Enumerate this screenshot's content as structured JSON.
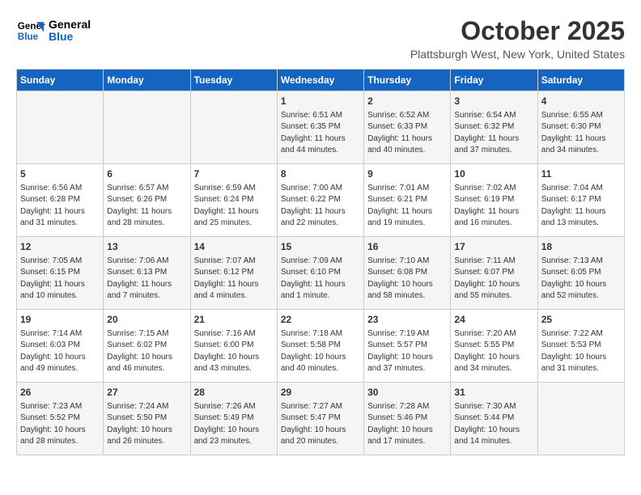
{
  "logo": {
    "line1": "General",
    "line2": "Blue"
  },
  "title": "October 2025",
  "subtitle": "Plattsburgh West, New York, United States",
  "days_of_week": [
    "Sunday",
    "Monday",
    "Tuesday",
    "Wednesday",
    "Thursday",
    "Friday",
    "Saturday"
  ],
  "weeks": [
    [
      {
        "day": "",
        "info": ""
      },
      {
        "day": "",
        "info": ""
      },
      {
        "day": "",
        "info": ""
      },
      {
        "day": "1",
        "info": "Sunrise: 6:51 AM\nSunset: 6:35 PM\nDaylight: 11 hours\nand 44 minutes."
      },
      {
        "day": "2",
        "info": "Sunrise: 6:52 AM\nSunset: 6:33 PM\nDaylight: 11 hours\nand 40 minutes."
      },
      {
        "day": "3",
        "info": "Sunrise: 6:54 AM\nSunset: 6:32 PM\nDaylight: 11 hours\nand 37 minutes."
      },
      {
        "day": "4",
        "info": "Sunrise: 6:55 AM\nSunset: 6:30 PM\nDaylight: 11 hours\nand 34 minutes."
      }
    ],
    [
      {
        "day": "5",
        "info": "Sunrise: 6:56 AM\nSunset: 6:28 PM\nDaylight: 11 hours\nand 31 minutes."
      },
      {
        "day": "6",
        "info": "Sunrise: 6:57 AM\nSunset: 6:26 PM\nDaylight: 11 hours\nand 28 minutes."
      },
      {
        "day": "7",
        "info": "Sunrise: 6:59 AM\nSunset: 6:24 PM\nDaylight: 11 hours\nand 25 minutes."
      },
      {
        "day": "8",
        "info": "Sunrise: 7:00 AM\nSunset: 6:22 PM\nDaylight: 11 hours\nand 22 minutes."
      },
      {
        "day": "9",
        "info": "Sunrise: 7:01 AM\nSunset: 6:21 PM\nDaylight: 11 hours\nand 19 minutes."
      },
      {
        "day": "10",
        "info": "Sunrise: 7:02 AM\nSunset: 6:19 PM\nDaylight: 11 hours\nand 16 minutes."
      },
      {
        "day": "11",
        "info": "Sunrise: 7:04 AM\nSunset: 6:17 PM\nDaylight: 11 hours\nand 13 minutes."
      }
    ],
    [
      {
        "day": "12",
        "info": "Sunrise: 7:05 AM\nSunset: 6:15 PM\nDaylight: 11 hours\nand 10 minutes."
      },
      {
        "day": "13",
        "info": "Sunrise: 7:06 AM\nSunset: 6:13 PM\nDaylight: 11 hours\nand 7 minutes."
      },
      {
        "day": "14",
        "info": "Sunrise: 7:07 AM\nSunset: 6:12 PM\nDaylight: 11 hours\nand 4 minutes."
      },
      {
        "day": "15",
        "info": "Sunrise: 7:09 AM\nSunset: 6:10 PM\nDaylight: 11 hours\nand 1 minute."
      },
      {
        "day": "16",
        "info": "Sunrise: 7:10 AM\nSunset: 6:08 PM\nDaylight: 10 hours\nand 58 minutes."
      },
      {
        "day": "17",
        "info": "Sunrise: 7:11 AM\nSunset: 6:07 PM\nDaylight: 10 hours\nand 55 minutes."
      },
      {
        "day": "18",
        "info": "Sunrise: 7:13 AM\nSunset: 6:05 PM\nDaylight: 10 hours\nand 52 minutes."
      }
    ],
    [
      {
        "day": "19",
        "info": "Sunrise: 7:14 AM\nSunset: 6:03 PM\nDaylight: 10 hours\nand 49 minutes."
      },
      {
        "day": "20",
        "info": "Sunrise: 7:15 AM\nSunset: 6:02 PM\nDaylight: 10 hours\nand 46 minutes."
      },
      {
        "day": "21",
        "info": "Sunrise: 7:16 AM\nSunset: 6:00 PM\nDaylight: 10 hours\nand 43 minutes."
      },
      {
        "day": "22",
        "info": "Sunrise: 7:18 AM\nSunset: 5:58 PM\nDaylight: 10 hours\nand 40 minutes."
      },
      {
        "day": "23",
        "info": "Sunrise: 7:19 AM\nSunset: 5:57 PM\nDaylight: 10 hours\nand 37 minutes."
      },
      {
        "day": "24",
        "info": "Sunrise: 7:20 AM\nSunset: 5:55 PM\nDaylight: 10 hours\nand 34 minutes."
      },
      {
        "day": "25",
        "info": "Sunrise: 7:22 AM\nSunset: 5:53 PM\nDaylight: 10 hours\nand 31 minutes."
      }
    ],
    [
      {
        "day": "26",
        "info": "Sunrise: 7:23 AM\nSunset: 5:52 PM\nDaylight: 10 hours\nand 28 minutes."
      },
      {
        "day": "27",
        "info": "Sunrise: 7:24 AM\nSunset: 5:50 PM\nDaylight: 10 hours\nand 26 minutes."
      },
      {
        "day": "28",
        "info": "Sunrise: 7:26 AM\nSunset: 5:49 PM\nDaylight: 10 hours\nand 23 minutes."
      },
      {
        "day": "29",
        "info": "Sunrise: 7:27 AM\nSunset: 5:47 PM\nDaylight: 10 hours\nand 20 minutes."
      },
      {
        "day": "30",
        "info": "Sunrise: 7:28 AM\nSunset: 5:46 PM\nDaylight: 10 hours\nand 17 minutes."
      },
      {
        "day": "31",
        "info": "Sunrise: 7:30 AM\nSunset: 5:44 PM\nDaylight: 10 hours\nand 14 minutes."
      },
      {
        "day": "",
        "info": ""
      }
    ]
  ]
}
